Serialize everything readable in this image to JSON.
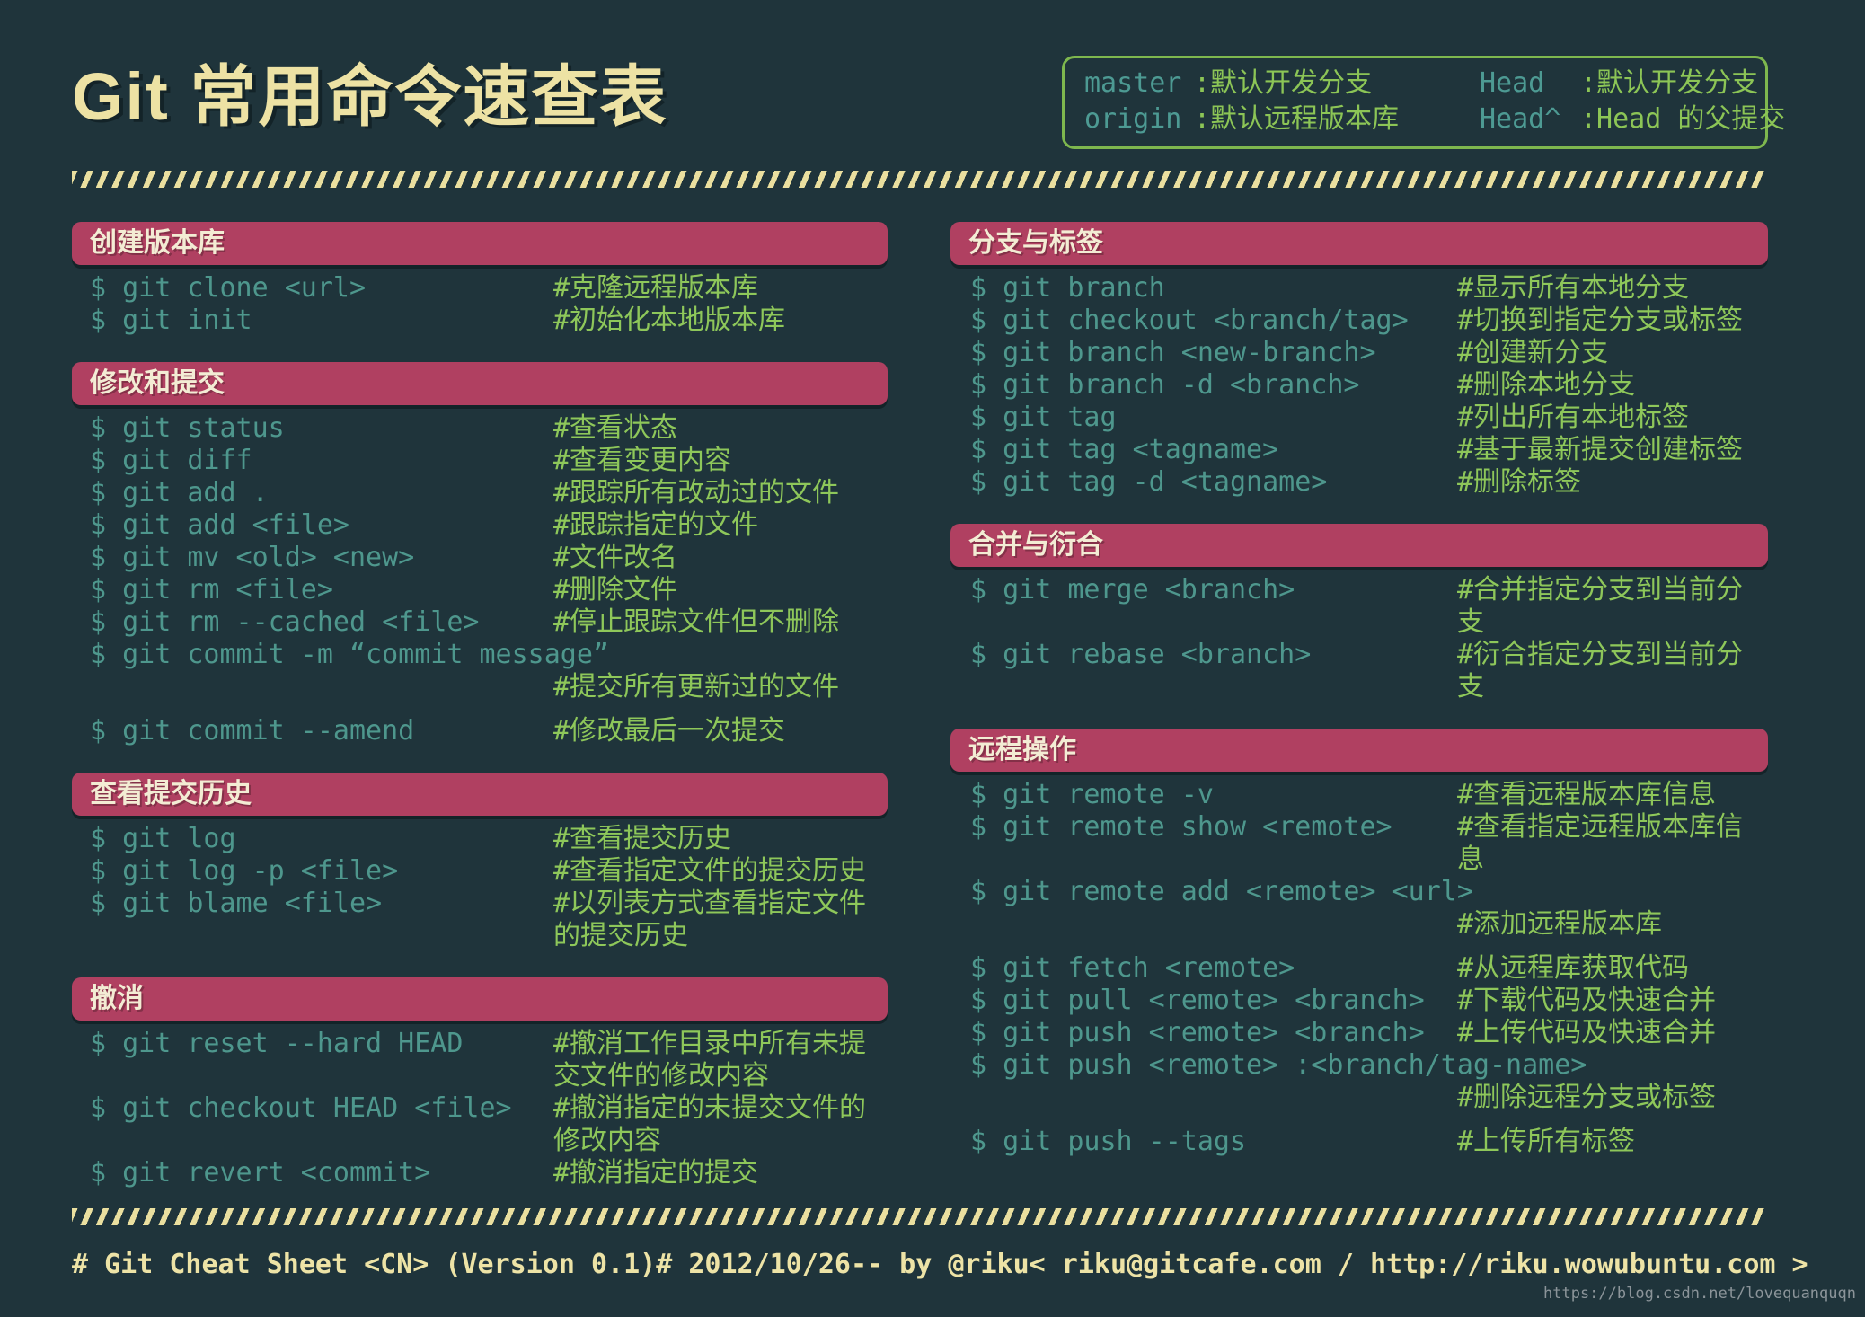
{
  "page": {
    "title": "Git 常用命令速查表",
    "watermark": "https://blog.csdn.net/lovequanquqn"
  },
  "colors": {
    "background": "#1f343b",
    "section_bar": "#b04061",
    "command_text": "#4e978d",
    "comment_text": "#8ec75a",
    "cream_text": "#ede2a4",
    "legend_border": "#7eb74e"
  },
  "legend": {
    "items": [
      {
        "term": "master",
        "desc": ":默认开发分支"
      },
      {
        "term": "origin",
        "desc": ":默认远程版本库"
      },
      {
        "term": "Head",
        "desc": ":默认开发分支"
      },
      {
        "term": "Head^",
        "desc": ":Head 的父提交"
      }
    ]
  },
  "columns": {
    "left": [
      {
        "title": "创建版本库",
        "rows": [
          {
            "cmd": "$ git clone <url>",
            "comment": "#克隆远程版本库"
          },
          {
            "cmd": "$ git init",
            "comment": "#初始化本地版本库"
          }
        ]
      },
      {
        "title": "修改和提交",
        "rows": [
          {
            "cmd": "$ git status",
            "comment": "#查看状态"
          },
          {
            "cmd": "$ git diff",
            "comment": "#查看变更内容"
          },
          {
            "cmd": "$ git add .",
            "comment": "#跟踪所有改动过的文件"
          },
          {
            "cmd": "$ git add <file>",
            "comment": "#跟踪指定的文件"
          },
          {
            "cmd": "$ git mv <old> <new>",
            "comment": "#文件改名"
          },
          {
            "cmd": "$ git rm <file>",
            "comment": "#删除文件"
          },
          {
            "cmd": "$ git rm --cached <file>",
            "comment": "#停止跟踪文件但不删除"
          },
          {
            "cmd": "$ git commit -m “commit message”",
            "comment": "#提交所有更新过的文件",
            "own_line": true,
            "gap_after": true
          },
          {
            "cmd": "$ git commit --amend",
            "comment": "#修改最后一次提交"
          }
        ]
      },
      {
        "title": "查看提交历史",
        "rows": [
          {
            "cmd": "$ git log",
            "comment": "#查看提交历史"
          },
          {
            "cmd": "$ git log -p <file>",
            "comment": "#查看指定文件的提交历史"
          },
          {
            "cmd": "$ git blame <file>",
            "comment": "#以列表方式查看指定文件的提交历史"
          }
        ]
      },
      {
        "title": "撤消",
        "rows": [
          {
            "cmd": "$ git reset --hard HEAD",
            "comment": "#撤消工作目录中所有未提交文件的修改内容"
          },
          {
            "cmd": "$ git checkout HEAD <file>",
            "comment": "#撤消指定的未提交文件的修改内容"
          },
          {
            "cmd": "$ git revert <commit>",
            "comment": "#撤消指定的提交"
          }
        ]
      }
    ],
    "right": [
      {
        "title": "分支与标签",
        "rows": [
          {
            "cmd": "$ git branch",
            "comment": "#显示所有本地分支"
          },
          {
            "cmd": "$ git checkout <branch/tag>",
            "comment": "#切换到指定分支或标签"
          },
          {
            "cmd": "$ git branch <new-branch>",
            "comment": "#创建新分支"
          },
          {
            "cmd": "$ git branch -d <branch>",
            "comment": "#删除本地分支"
          },
          {
            "cmd": "$ git tag",
            "comment": "#列出所有本地标签"
          },
          {
            "cmd": "$ git tag <tagname>",
            "comment": "#基于最新提交创建标签"
          },
          {
            "cmd": "$ git tag -d <tagname>",
            "comment": "#删除标签"
          }
        ]
      },
      {
        "title": "合并与衍合",
        "rows": [
          {
            "cmd": "$ git merge <branch>",
            "comment": "#合并指定分支到当前分支"
          },
          {
            "cmd": "$ git rebase <branch>",
            "comment": "#衍合指定分支到当前分支"
          }
        ]
      },
      {
        "title": "远程操作",
        "rows": [
          {
            "cmd": "$ git remote -v",
            "comment": "#查看远程版本库信息"
          },
          {
            "cmd": "$ git remote show <remote>",
            "comment": "#查看指定远程版本库信息"
          },
          {
            "cmd": "$ git remote add <remote> <url>",
            "comment": "#添加远程版本库",
            "own_line": true,
            "gap_after": true
          },
          {
            "cmd": "$ git fetch <remote>",
            "comment": "#从远程库获取代码"
          },
          {
            "cmd": "$ git pull <remote> <branch>",
            "comment": "#下载代码及快速合并"
          },
          {
            "cmd": "$ git push <remote> <branch>",
            "comment": "#上传代码及快速合并"
          },
          {
            "cmd": "$ git push <remote> :<branch/tag-name>",
            "comment": "#删除远程分支或标签",
            "own_line": true,
            "gap_after": true
          },
          {
            "cmd": "$ git push --tags",
            "comment": "#上传所有标签"
          }
        ]
      }
    ]
  },
  "footer": {
    "sheet": "# Git Cheat Sheet <CN> (Version 0.1)",
    "date": "# 2012/10/26",
    "author": "-- by @riku",
    "contact": "< riku@gitcafe.com / http://riku.wowubuntu.com >"
  }
}
